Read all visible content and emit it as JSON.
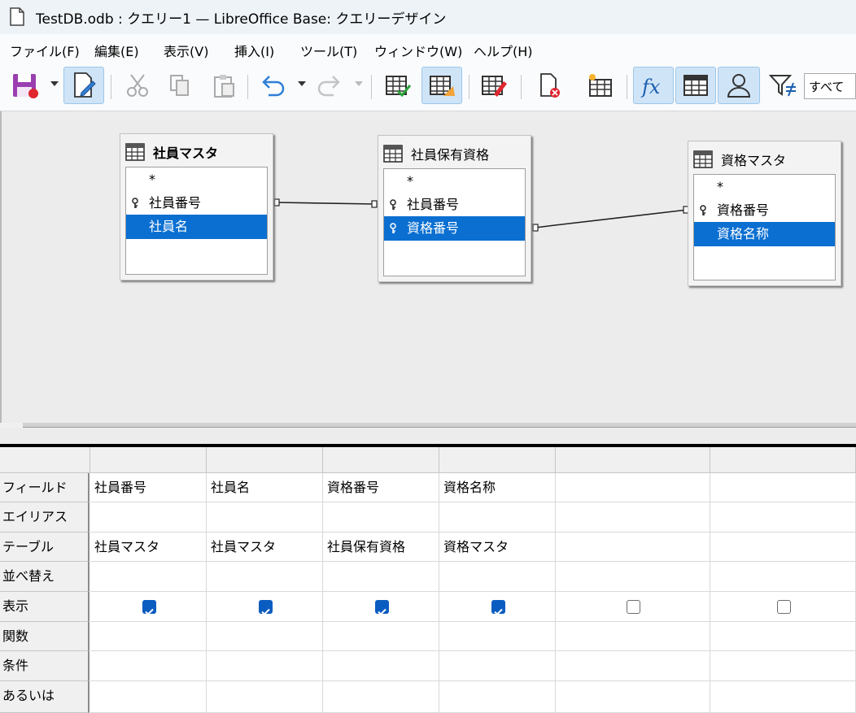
{
  "window": {
    "title": "TestDB.odb : クエリー1 — LibreOffice Base: クエリーデザイン"
  },
  "menu": [
    "ファイル(F)",
    "編集(E)",
    "表示(V)",
    "挿入(I)",
    "ツール(T)",
    "ウィンドウ(W)",
    "ヘルプ(H)"
  ],
  "toolbar": {
    "icons": [
      "save-icon",
      "edit-icon",
      "cut-icon",
      "copy-icon",
      "paste-icon",
      "undo-icon",
      "redo-icon",
      "run-query-icon",
      "clear-query-icon",
      "switch-design-icon",
      "delete-table-icon",
      "add-table-icon",
      "functions-icon",
      "table-names-icon",
      "alias-icon",
      "distinct-filter-icon"
    ],
    "active": [
      "edit-icon",
      "clear-query-icon",
      "functions-icon",
      "table-names-icon",
      "alias-icon"
    ],
    "filter_value": "すべて",
    "accent": "#0b6fd1"
  },
  "tables": [
    {
      "name": "社員マスタ",
      "fields": [
        {
          "label": "*",
          "key": false,
          "selected": false
        },
        {
          "label": "社員番号",
          "key": true,
          "selected": false
        },
        {
          "label": "社員名",
          "key": false,
          "selected": true
        }
      ]
    },
    {
      "name": "社員保有資格",
      "fields": [
        {
          "label": "*",
          "key": false,
          "selected": false
        },
        {
          "label": "社員番号",
          "key": true,
          "selected": false
        },
        {
          "label": "資格番号",
          "key": true,
          "selected": true
        }
      ]
    },
    {
      "name": "資格マスタ",
      "fields": [
        {
          "label": "*",
          "key": false,
          "selected": false
        },
        {
          "label": "資格番号",
          "key": true,
          "selected": false
        },
        {
          "label": "資格名称",
          "key": false,
          "selected": true
        }
      ]
    }
  ],
  "grid": {
    "row_labels": [
      "フィールド",
      "エイリアス",
      "テーブル",
      "並べ替え",
      "表示",
      "関数",
      "条件",
      "あるいは"
    ],
    "columns": [
      {
        "field": "社員番号",
        "alias": "",
        "table": "社員マスタ",
        "sort": "",
        "visible": true,
        "function": "",
        "criteria": "",
        "or": ""
      },
      {
        "field": "社員名",
        "alias": "",
        "table": "社員マスタ",
        "sort": "",
        "visible": true,
        "function": "",
        "criteria": "",
        "or": ""
      },
      {
        "field": "資格番号",
        "alias": "",
        "table": "社員保有資格",
        "sort": "",
        "visible": true,
        "function": "",
        "criteria": "",
        "or": ""
      },
      {
        "field": "資格名称",
        "alias": "",
        "table": "資格マスタ",
        "sort": "",
        "visible": true,
        "function": "",
        "criteria": "",
        "or": ""
      },
      {
        "field": "",
        "alias": "",
        "table": "",
        "sort": "",
        "visible": false,
        "function": "",
        "criteria": "",
        "or": ""
      },
      {
        "field": "",
        "alias": "",
        "table": "",
        "sort": "",
        "visible": false,
        "function": "",
        "criteria": "",
        "or": ""
      }
    ]
  }
}
